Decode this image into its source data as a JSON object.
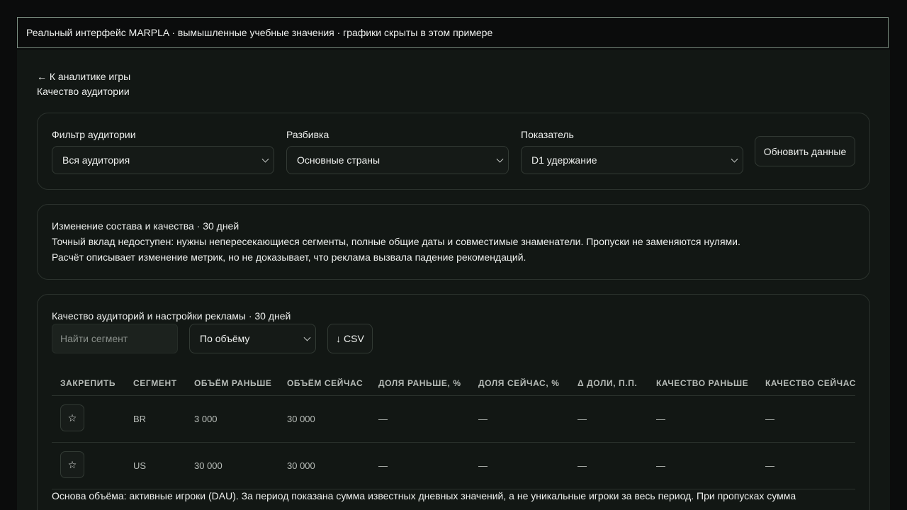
{
  "banner": "Реальный интерфейс MARPLA · вымышленные учебные значения · графики скрыты в этом примере",
  "nav": {
    "back_label": "← К аналитике игры",
    "page_title": "Качество аудитории"
  },
  "filters": {
    "audience": {
      "label": "Фильтр аудитории",
      "value": "Вся аудитория"
    },
    "breakdown": {
      "label": "Разбивка",
      "value": "Основные страны"
    },
    "metric": {
      "label": "Показатель",
      "value": "D1 удержание"
    },
    "refresh_label": "Обновить данные"
  },
  "info": {
    "title": "Изменение состава и качества · 30 дней",
    "line1": "Точный вклад недоступен: нужны непересекающиеся сегменты, полные общие даты и совместимые знаменатели. Пропуски не заменяются нулями.",
    "line2": "Расчёт описывает изменение метрик, но не доказывает, что реклама вызвала падение рекомендаций."
  },
  "table_section": {
    "title": "Качество аудиторий и настройки рекламы · 30 дней",
    "search_placeholder": "Найти сегмент",
    "sort_value": "По объёму",
    "csv_label": "↓ CSV",
    "columns": [
      "ЗАКРЕПИТЬ",
      "СЕГМЕНТ",
      "ОБЪЁМ РАНЬШЕ",
      "ОБЪЁМ СЕЙЧАС",
      "ДОЛЯ РАНЬШЕ, %",
      "ДОЛЯ СЕЙЧАС, %",
      "Δ ДОЛИ, П.П.",
      "КАЧЕСТВО РАНЬШЕ",
      "КАЧЕСТВО СЕЙЧАС"
    ],
    "rows": [
      {
        "pin": "☆",
        "segment": "BR",
        "vol_before": "3 000",
        "vol_now": "30 000",
        "share_before": "—",
        "share_now": "—",
        "share_delta": "—",
        "quality_before": "—",
        "quality_now": "—"
      },
      {
        "pin": "☆",
        "segment": "US",
        "vol_before": "30 000",
        "vol_now": "30 000",
        "share_before": "—",
        "share_now": "—",
        "share_delta": "—",
        "quality_before": "—",
        "quality_now": "—"
      }
    ],
    "footnote": "Основа объёма: активные игроки (DAU). За период показана сумма известных дневных значений, а не уникальные игроки за весь период. При пропусках сумма"
  }
}
